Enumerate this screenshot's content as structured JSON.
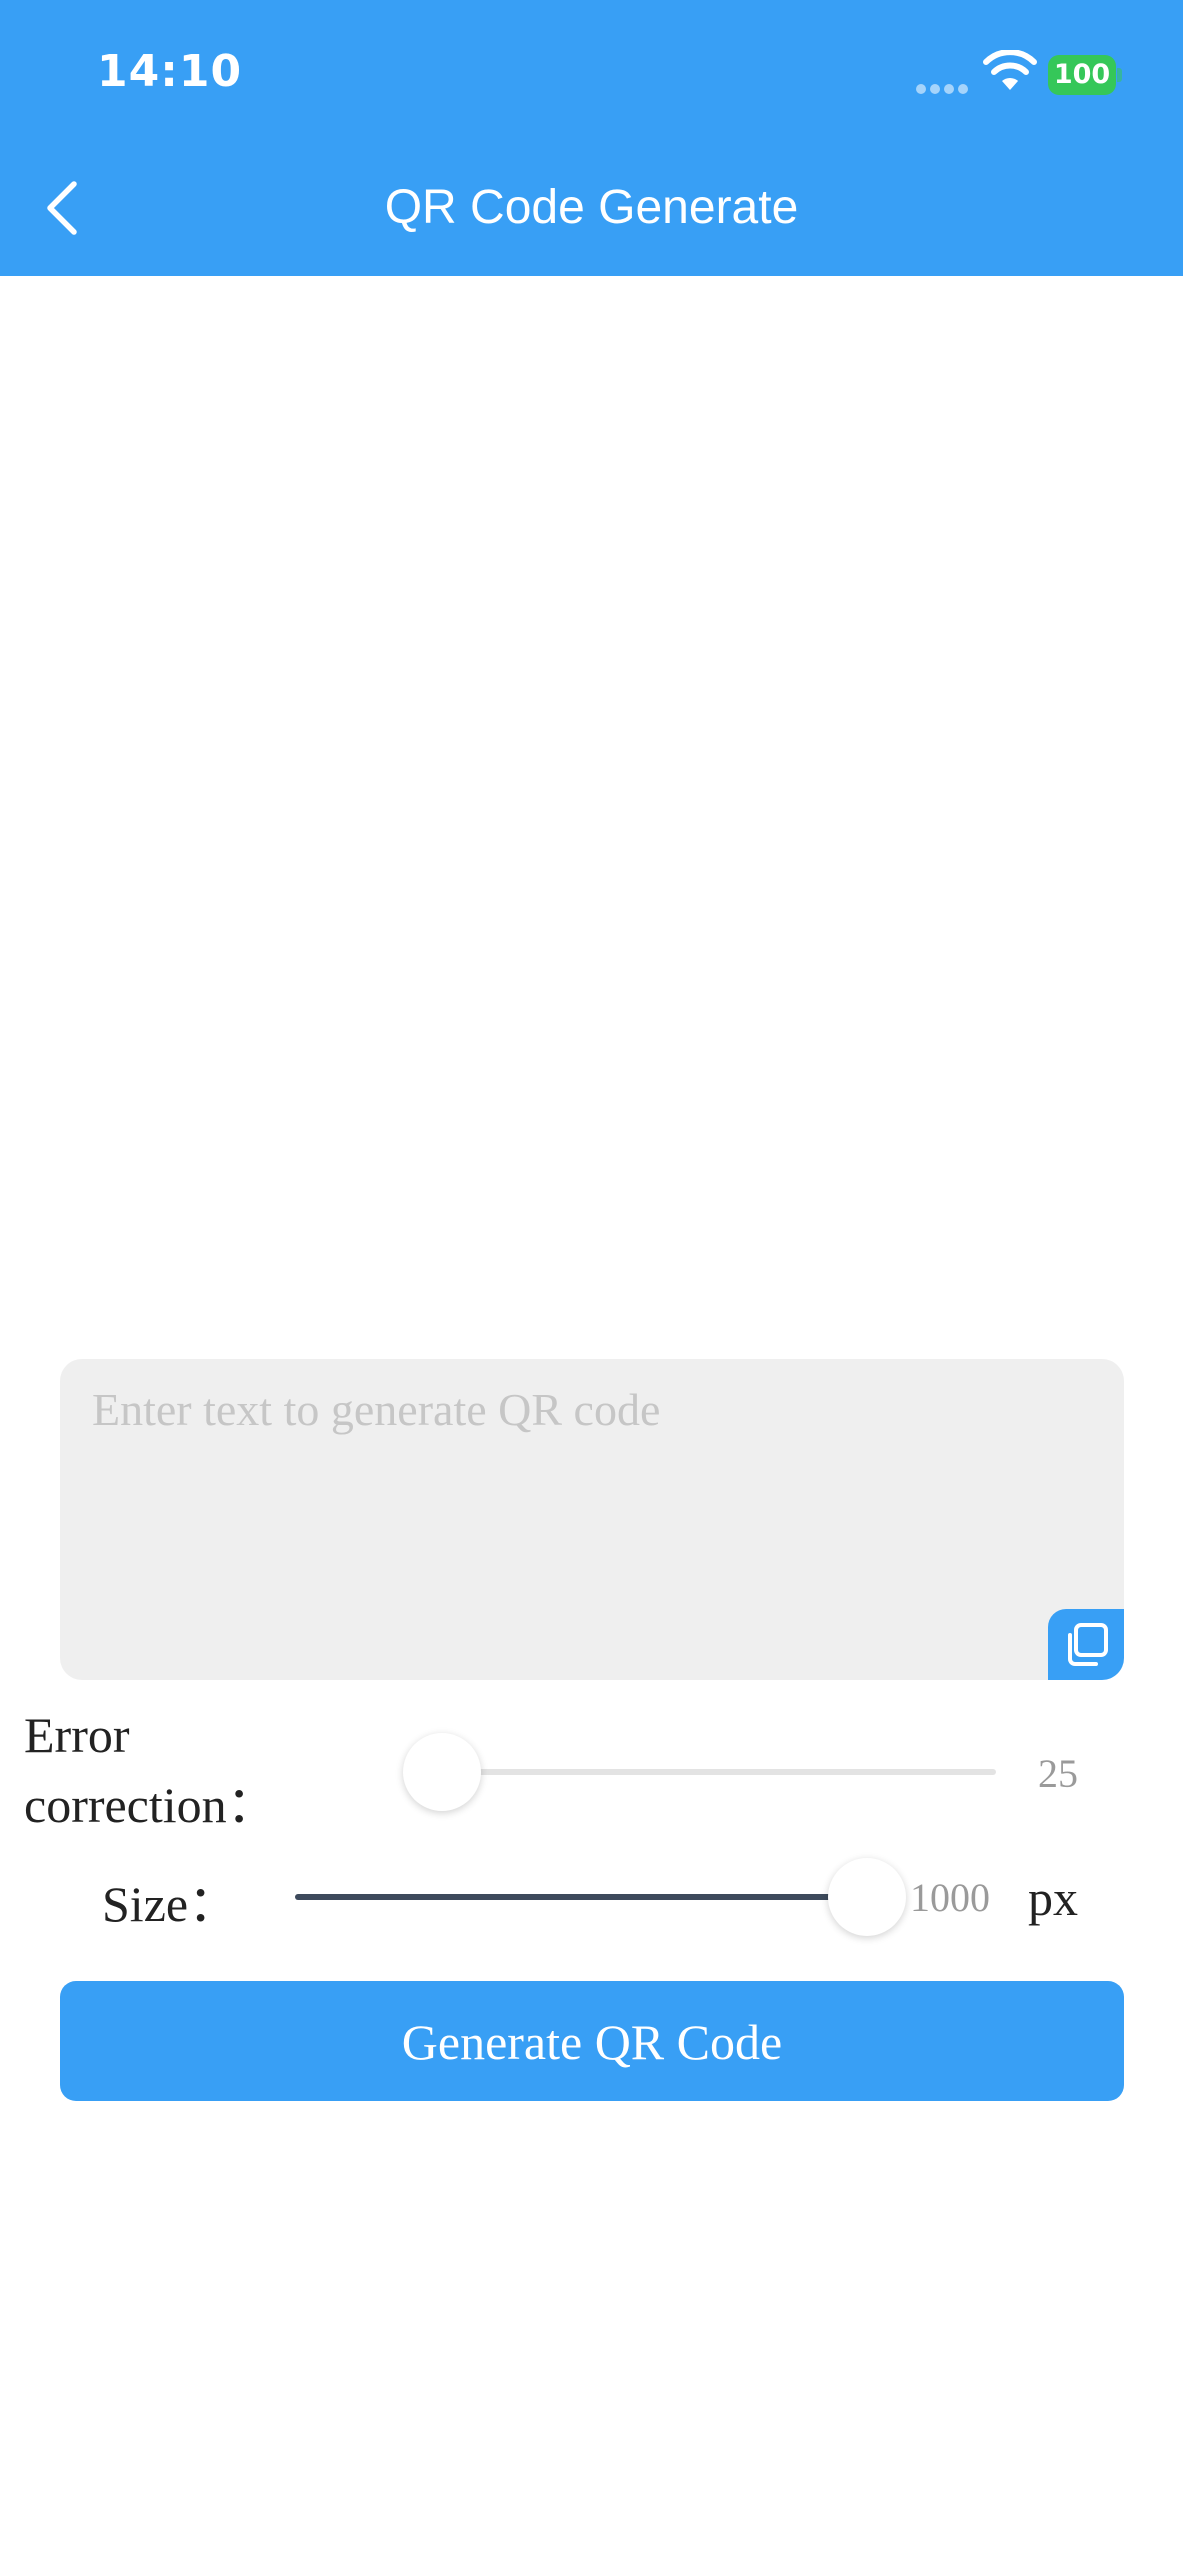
{
  "status_bar": {
    "time": "14:10",
    "battery": "100",
    "battery_color": "#35c759"
  },
  "header": {
    "title": "QR Code Generate",
    "back_icon": "chevron-left-icon",
    "background": "#389ff5"
  },
  "input": {
    "placeholder": "Enter text to generate QR code",
    "value": "",
    "copy_icon": "copy-icon"
  },
  "error_correction": {
    "label_line1": "Error",
    "label_line2": "correction：",
    "value": "25",
    "level": 0.0
  },
  "size": {
    "label": "Size：",
    "value": "1000",
    "unit": "px",
    "level": 1.0
  },
  "generate_button": {
    "label": "Generate QR Code"
  },
  "accent_color": "#389ff5"
}
